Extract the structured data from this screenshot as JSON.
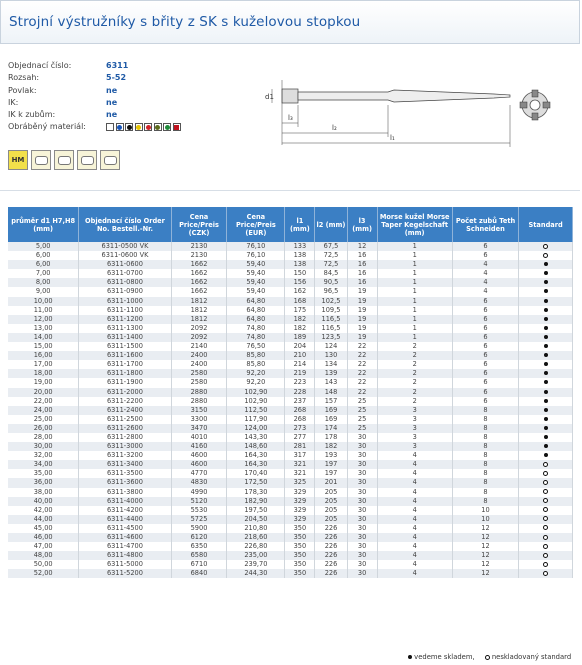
{
  "title": "Strojní výstružníky s břity z SK s kuželovou stopkou",
  "info": [
    {
      "label": "Objednací číslo:",
      "value": "6311"
    },
    {
      "label": "Rozsah:",
      "value": "5-52"
    },
    {
      "label": "Povlak:",
      "value": "ne"
    },
    {
      "label": "IK:",
      "value": "ne"
    },
    {
      "label": "IK k zubům:",
      "value": "ne"
    },
    {
      "label": "Obráběný materiál:",
      "value": ""
    }
  ],
  "materials": [
    {
      "name": "material-white",
      "color": "#ffffff"
    },
    {
      "name": "material-blue",
      "color": "#1a56b8"
    },
    {
      "name": "material-black",
      "color": "#111111"
    },
    {
      "name": "material-yellow",
      "color": "#e8c500"
    },
    {
      "name": "material-red",
      "color": "#d1242a"
    },
    {
      "name": "material-olive",
      "color": "#5c6b1c"
    },
    {
      "name": "material-green",
      "color": "#1f8a3a"
    },
    {
      "name": "material-red-square",
      "color": "#c1121f"
    }
  ],
  "icons": [
    "HM",
    "",
    "",
    "",
    ""
  ],
  "drawing_labels": {
    "d1": "d1",
    "l1": "l₁",
    "l2": "l₂",
    "l3": "l₃"
  },
  "table": {
    "headers": [
      "průměr d1 H7,H8 (mm)",
      "Objednací číslo Order No. Bestell.-Nr.",
      "Cena Price/Preis (CZK)",
      "Cena Price/Preis (EUR)",
      "l1 (mm)",
      "l2 (mm)",
      "l3 (mm)",
      "Morse kužel Morse Taper Kegelschaft (mm)",
      "Počet zubů Teth Schneiden",
      "Standard"
    ],
    "rows": [
      [
        "5,00",
        "6311-0500 VK",
        "2130",
        "76,10",
        "133",
        "67,5",
        "12",
        "1",
        "6",
        "empty"
      ],
      [
        "6,00",
        "6311-0600 VK",
        "2130",
        "76,10",
        "138",
        "72,5",
        "16",
        "1",
        "6",
        "empty"
      ],
      [
        "6,00",
        "6311-0600",
        "1662",
        "59,40",
        "138",
        "72,5",
        "16",
        "1",
        "4",
        "full"
      ],
      [
        "7,00",
        "6311-0700",
        "1662",
        "59,40",
        "150",
        "84,5",
        "16",
        "1",
        "4",
        "full"
      ],
      [
        "8,00",
        "6311-0800",
        "1662",
        "59,40",
        "156",
        "90,5",
        "16",
        "1",
        "4",
        "full"
      ],
      [
        "9,00",
        "6311-0900",
        "1662",
        "59,40",
        "162",
        "96,5",
        "19",
        "1",
        "4",
        "full"
      ],
      [
        "10,00",
        "6311-1000",
        "1812",
        "64,80",
        "168",
        "102,5",
        "19",
        "1",
        "6",
        "full"
      ],
      [
        "11,00",
        "6311-1100",
        "1812",
        "64,80",
        "175",
        "109,5",
        "19",
        "1",
        "6",
        "full"
      ],
      [
        "12,00",
        "6311-1200",
        "1812",
        "64,80",
        "182",
        "116,5",
        "19",
        "1",
        "6",
        "full"
      ],
      [
        "13,00",
        "6311-1300",
        "2092",
        "74,80",
        "182",
        "116,5",
        "19",
        "1",
        "6",
        "full"
      ],
      [
        "14,00",
        "6311-1400",
        "2092",
        "74,80",
        "189",
        "123,5",
        "19",
        "1",
        "6",
        "full"
      ],
      [
        "15,00",
        "6311-1500",
        "2140",
        "76,50",
        "204",
        "124",
        "22",
        "2",
        "6",
        "full"
      ],
      [
        "16,00",
        "6311-1600",
        "2400",
        "85,80",
        "210",
        "130",
        "22",
        "2",
        "6",
        "full"
      ],
      [
        "17,00",
        "6311-1700",
        "2400",
        "85,80",
        "214",
        "134",
        "22",
        "2",
        "6",
        "full"
      ],
      [
        "18,00",
        "6311-1800",
        "2580",
        "92,20",
        "219",
        "139",
        "22",
        "2",
        "6",
        "full"
      ],
      [
        "19,00",
        "6311-1900",
        "2580",
        "92,20",
        "223",
        "143",
        "22",
        "2",
        "6",
        "full"
      ],
      [
        "20,00",
        "6311-2000",
        "2880",
        "102,90",
        "228",
        "148",
        "22",
        "2",
        "6",
        "full"
      ],
      [
        "22,00",
        "6311-2200",
        "2880",
        "102,90",
        "237",
        "157",
        "25",
        "2",
        "6",
        "full"
      ],
      [
        "24,00",
        "6311-2400",
        "3150",
        "112,50",
        "268",
        "169",
        "25",
        "3",
        "8",
        "full"
      ],
      [
        "25,00",
        "6311-2500",
        "3300",
        "117,90",
        "268",
        "169",
        "25",
        "3",
        "8",
        "full"
      ],
      [
        "26,00",
        "6311-2600",
        "3470",
        "124,00",
        "273",
        "174",
        "25",
        "3",
        "8",
        "full"
      ],
      [
        "28,00",
        "6311-2800",
        "4010",
        "143,30",
        "277",
        "178",
        "30",
        "3",
        "8",
        "full"
      ],
      [
        "30,00",
        "6311-3000",
        "4160",
        "148,60",
        "281",
        "182",
        "30",
        "3",
        "8",
        "full"
      ],
      [
        "32,00",
        "6311-3200",
        "4600",
        "164,30",
        "317",
        "193",
        "30",
        "4",
        "8",
        "full"
      ],
      [
        "34,00",
        "6311-3400",
        "4600",
        "164,30",
        "321",
        "197",
        "30",
        "4",
        "8",
        "empty"
      ],
      [
        "35,00",
        "6311-3500",
        "4770",
        "170,40",
        "321",
        "197",
        "30",
        "4",
        "8",
        "empty"
      ],
      [
        "36,00",
        "6311-3600",
        "4830",
        "172,50",
        "325",
        "201",
        "30",
        "4",
        "8",
        "empty"
      ],
      [
        "38,00",
        "6311-3800",
        "4990",
        "178,30",
        "329",
        "205",
        "30",
        "4",
        "8",
        "empty"
      ],
      [
        "40,00",
        "6311-4000",
        "5120",
        "182,90",
        "329",
        "205",
        "30",
        "4",
        "8",
        "empty"
      ],
      [
        "42,00",
        "6311-4200",
        "5530",
        "197,50",
        "329",
        "205",
        "30",
        "4",
        "10",
        "empty"
      ],
      [
        "44,00",
        "6311-4400",
        "5725",
        "204,50",
        "329",
        "205",
        "30",
        "4",
        "10",
        "empty"
      ],
      [
        "45,00",
        "6311-4500",
        "5900",
        "210,80",
        "350",
        "226",
        "30",
        "4",
        "12",
        "empty"
      ],
      [
        "46,00",
        "6311-4600",
        "6120",
        "218,60",
        "350",
        "226",
        "30",
        "4",
        "12",
        "empty"
      ],
      [
        "47,00",
        "6311-4700",
        "6350",
        "226,80",
        "350",
        "226",
        "30",
        "4",
        "12",
        "empty"
      ],
      [
        "48,00",
        "6311-4800",
        "6580",
        "235,00",
        "350",
        "226",
        "30",
        "4",
        "12",
        "empty"
      ],
      [
        "50,00",
        "6311-5000",
        "6710",
        "239,70",
        "350",
        "226",
        "30",
        "4",
        "12",
        "empty"
      ],
      [
        "52,00",
        "6311-5200",
        "6840",
        "244,30",
        "350",
        "226",
        "30",
        "4",
        "12",
        "empty"
      ]
    ]
  },
  "legend": {
    "full": "vedeme skladem,",
    "empty": "neskladovaný standard"
  }
}
